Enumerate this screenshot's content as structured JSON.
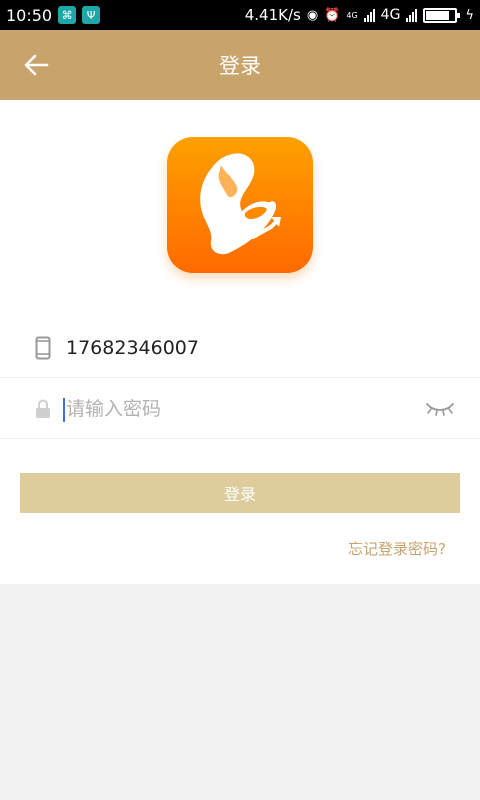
{
  "status_bar": {
    "time": "10:50",
    "app_icon_1": "⌘",
    "app_icon_2": "Ψ",
    "speed": "4.41K/s",
    "location_glyph": "◉",
    "alarm_glyph": "⏰",
    "network_small": "4G",
    "network": "4G",
    "battery_level": 0.8
  },
  "header": {
    "title": "登录",
    "back_icon": "arrow-left-icon"
  },
  "form": {
    "phone_value": "17682346007",
    "password_value": "",
    "password_placeholder": "请输入密码"
  },
  "actions": {
    "login_label": "登录",
    "forgot_label": "忘记登录密码?"
  },
  "colors": {
    "header": "#c8a36c",
    "button": "#decc9c",
    "link": "#c8a36c",
    "logo_top": "#ffa000",
    "logo_bottom": "#ff6a00"
  }
}
